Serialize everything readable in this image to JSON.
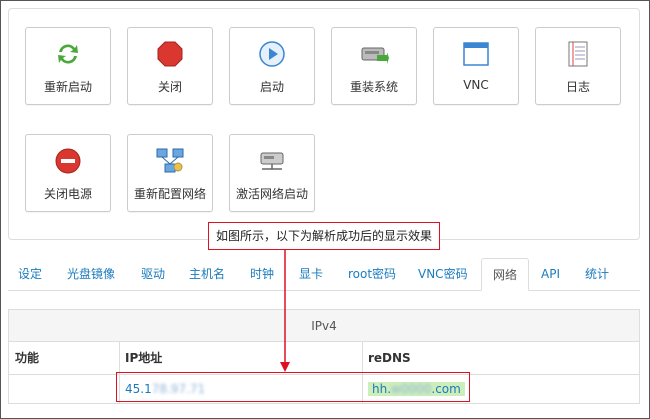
{
  "actions_row1": [
    {
      "label": "重新启动",
      "icon": "refresh-icon",
      "color": "#4aa83a"
    },
    {
      "label": "关闭",
      "icon": "stop-icon",
      "color": "#d9372f"
    },
    {
      "label": "启动",
      "icon": "play-icon",
      "color": "#3a86d1"
    },
    {
      "label": "重装系统",
      "icon": "reinstall-icon",
      "color": "#777777"
    },
    {
      "label": "VNC",
      "icon": "window-icon",
      "color": "#3a86d1"
    },
    {
      "label": "日志",
      "icon": "log-icon",
      "color": "#b33"
    }
  ],
  "actions_row2": [
    {
      "label": "关闭电源",
      "icon": "power-off-icon",
      "color": "#d9372f"
    },
    {
      "label": "重新配置网络",
      "icon": "network-config-icon",
      "color": "#3a86d1"
    },
    {
      "label": "激活网络启动",
      "icon": "network-boot-icon",
      "color": "#777777"
    }
  ],
  "annotation": "如图所示，以下为解析成功后的显示效果",
  "tabs": [
    "设定",
    "光盘镜像",
    "驱动",
    "主机名",
    "时钟",
    "显卡",
    "root密码",
    "VNC密码",
    "网络",
    "API",
    "统计"
  ],
  "active_tab": "网络",
  "table": {
    "caption": "IPv4",
    "headers": [
      "功能",
      "IP地址",
      "reDNS"
    ],
    "row": {
      "func": "",
      "ip_prefix": "45.1",
      "ip_hidden": "78.97.71",
      "dns_prefix": "hh.",
      "dns_hidden": "w0000",
      "dns_suffix": ".com"
    }
  }
}
